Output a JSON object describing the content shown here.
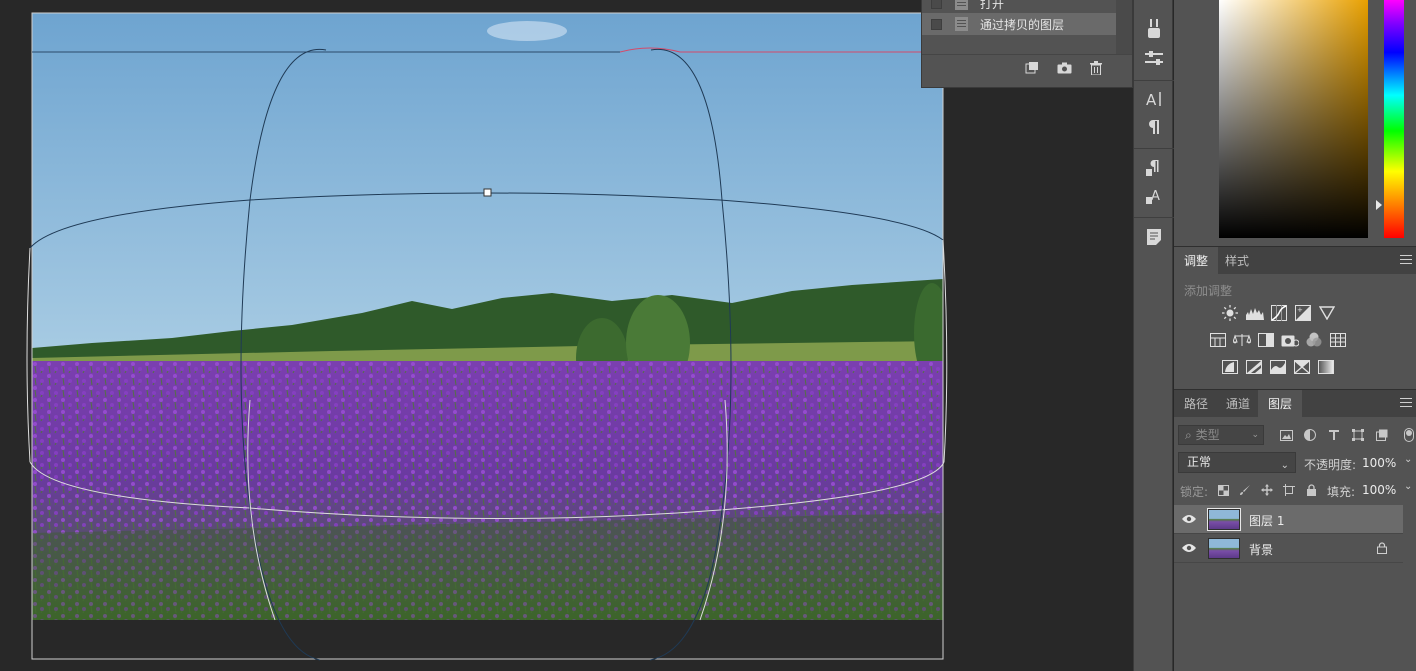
{
  "history": {
    "items": [
      {
        "label": "打开"
      },
      {
        "label": "通过拷贝的图层"
      }
    ],
    "footer_icons": [
      "new-document-from-state-icon",
      "snapshot-camera-icon",
      "trash-icon"
    ]
  },
  "strip_icons": [
    "brush-presets-icon",
    "sliders-icon",
    "character-icon",
    "paragraph-icon",
    "paragraph-styles-icon",
    "character-styles-icon",
    "notes-icon"
  ],
  "color": {
    "base": "#e8a000",
    "hue_bar": [
      "#ff00ff",
      "#0000ff",
      "#00ffff",
      "#00ff00",
      "#ffff00",
      "#ff0000"
    ]
  },
  "adjustments": {
    "tabs": [
      {
        "label": "调整"
      },
      {
        "label": "样式"
      }
    ],
    "title": "添加调整",
    "row1": [
      "brightness-icon",
      "levels-icon",
      "curves-icon",
      "exposure-icon",
      "vibrance-triangle-icon"
    ],
    "row2": [
      "hue-saturation-icon",
      "color-balance-icon",
      "black-white-icon",
      "photo-filter-icon",
      "channel-mixer-icon",
      "color-lookup-icon"
    ],
    "row3": [
      "invert-icon",
      "posterize-icon",
      "threshold-icon",
      "selective-color-icon",
      "gradient-map-icon"
    ]
  },
  "layers_panel": {
    "tabs": [
      {
        "label": "路径"
      },
      {
        "label": "通道"
      },
      {
        "label": "图层"
      }
    ],
    "filter_placeholder": "类型",
    "blend_mode": "正常",
    "opacity_label": "不透明度:",
    "opacity_value": "100%",
    "lock_label": "锁定:",
    "fill_label": "填充:",
    "fill_value": "100%",
    "layers": [
      {
        "name": "图层 1",
        "selected": true,
        "locked": false
      },
      {
        "name": "背景",
        "selected": false,
        "locked": true
      }
    ]
  }
}
